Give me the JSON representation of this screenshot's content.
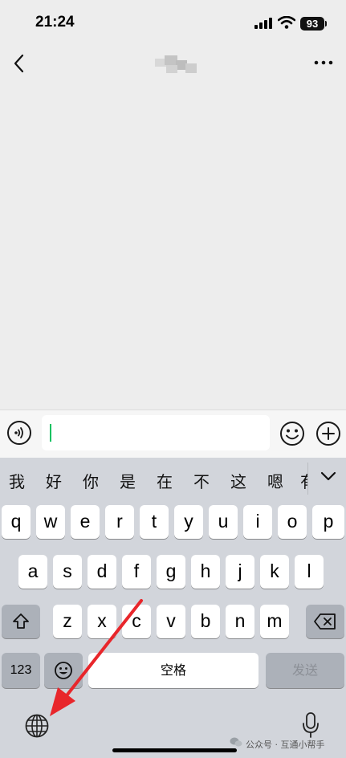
{
  "status_bar": {
    "time": "21:24",
    "battery_level": "93",
    "icons": [
      "signal-icon",
      "wifi-icon",
      "battery-icon"
    ]
  },
  "nav_bar": {
    "icons": [
      "back-icon",
      "more-icon"
    ]
  },
  "input_bar": {
    "text_value": "",
    "icons": [
      "voice-toggle-icon",
      "emoji-icon",
      "plus-icon"
    ]
  },
  "keyboard": {
    "candidates": [
      "我",
      "好",
      "你",
      "是",
      "在",
      "不",
      "这",
      "嗯",
      "有"
    ],
    "rows": [
      [
        "q",
        "w",
        "e",
        "r",
        "t",
        "y",
        "u",
        "i",
        "o",
        "p"
      ],
      [
        "a",
        "s",
        "d",
        "f",
        "g",
        "h",
        "j",
        "k",
        "l"
      ],
      [
        "z",
        "x",
        "c",
        "v",
        "b",
        "n",
        "m"
      ]
    ],
    "numbers_label": "123",
    "space_label": "空格",
    "send_label": "发送",
    "icons": [
      "shift-icon",
      "backspace-icon",
      "emoji-key-icon",
      "globe-icon",
      "mic-icon",
      "chevron-down-icon"
    ]
  },
  "watermark": {
    "text": "公众号 · 互通小帮手"
  },
  "colors": {
    "accent_caret": "#07c160",
    "annotation_arrow": "#e8262b",
    "keyboard_bg": "#d2d5db",
    "chat_bg": "#ededed"
  }
}
